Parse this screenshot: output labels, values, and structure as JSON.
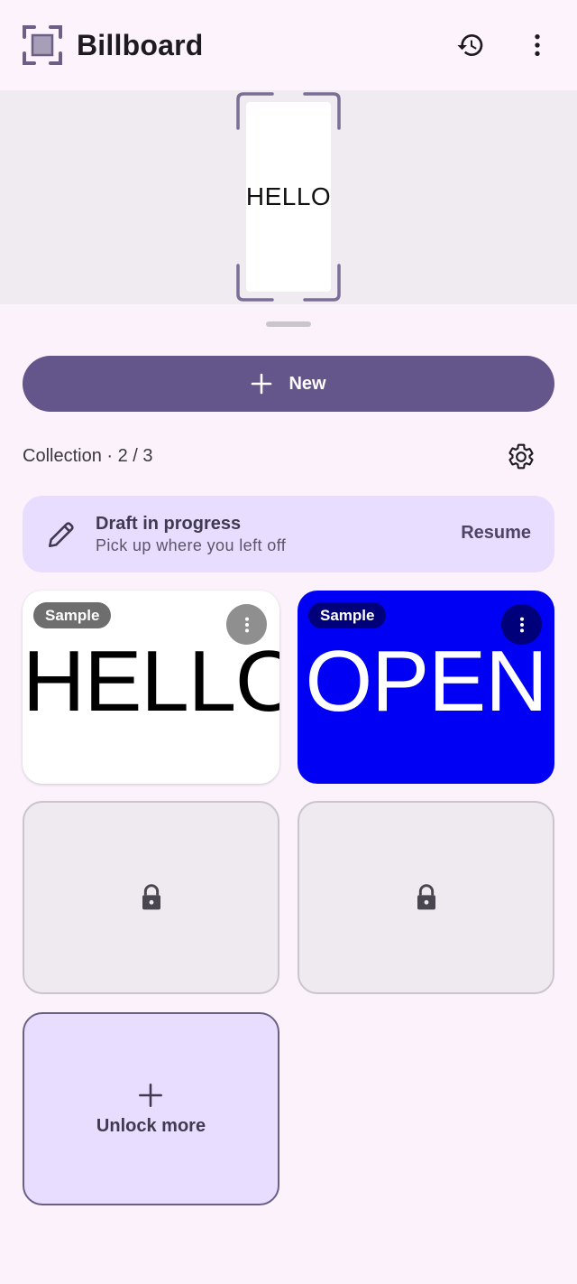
{
  "app": {
    "title": "Billboard"
  },
  "toolbar": {
    "history_icon": "history-icon",
    "more_icon": "more-vertical-icon"
  },
  "preview": {
    "text": "HELLO"
  },
  "new_button": {
    "label": "New",
    "icon": "plus-icon"
  },
  "collection": {
    "label": "Collection · 2 / 3",
    "settings_icon": "gear-icon"
  },
  "draft": {
    "title": "Draft in progress",
    "subtitle": "Pick up where you left off",
    "action": "Resume",
    "icon": "pencil-icon"
  },
  "tiles": [
    {
      "badge": "Sample",
      "text": "HELLO",
      "background": "#ffffff",
      "text_color": "#000000"
    },
    {
      "badge": "Sample",
      "text": "OPEN",
      "background": "#0000f5",
      "text_color": "#ffffff"
    }
  ],
  "locked_slots": 2,
  "unlock": {
    "label": "Unlock more",
    "icon": "plus-icon"
  },
  "colors": {
    "primary": "#64558b",
    "surface": "#fbf2fc",
    "draft_background": "#e9ddff"
  }
}
